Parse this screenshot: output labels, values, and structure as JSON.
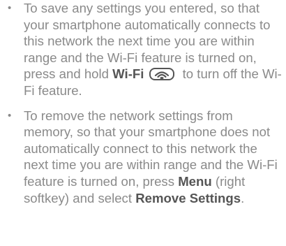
{
  "bullets": [
    {
      "text_before_term": "To save any settings you entered, so that your smartphone automatically connects to this network the next time you are within range and the Wi-Fi feature is turned on, press and hold ",
      "term": "Wi-Fi",
      "icon": "wifi-key-icon",
      "text_after_term": " to turn off the Wi-Fi feature."
    },
    {
      "text_before_term": "To remove the network settings from memory, so that your smartphone does not automatically connect to this network the next time you are within range and the Wi-Fi feature is turned on, press ",
      "term": "Menu",
      "text_middle": " (right softkey) and select ",
      "term2": "Remove Settings",
      "text_end": "."
    }
  ],
  "bullet_glyph": "•"
}
